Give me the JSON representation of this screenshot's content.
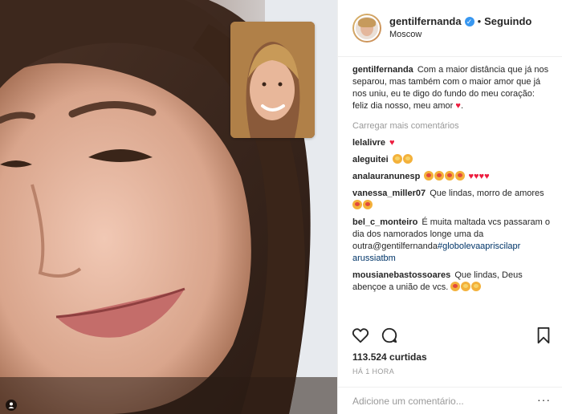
{
  "post": {
    "username": "gentilfernanda",
    "verified": true,
    "separator": "•",
    "follow_status": "Seguindo",
    "location": "Moscow",
    "caption": "Com a maior distância que já nos separou, mas também com o maior amor que já nos uniu, eu te digo do fundo do meu coração: feliz dia nosso, meu amor",
    "load_more": "Carregar mais comentários",
    "likes": "113.524 curtidas",
    "time": "HÁ 1 HORA",
    "add_comment_placeholder": "Adicione um comentário...",
    "more_options": "···"
  },
  "comments": [
    {
      "user": "lelalivre",
      "text": ""
    },
    {
      "user": "aleguitei",
      "text": ""
    },
    {
      "user": "analauranunesp",
      "text": ""
    },
    {
      "user": "vanessa_miller07",
      "text": "Que lindas, morro de amores"
    },
    {
      "user": "bel_c_monteiro",
      "text": "É muita maltada vcs passaram o dia dos namorados longe uma da outra@gentilfernanda",
      "tag": "#globolevaapriscilapr arussiatbm"
    },
    {
      "user": "mousianebastossoares",
      "text": "Que lindas, Deus abençoe a união de vcs."
    }
  ],
  "icons": {
    "like": "heart-outline-icon",
    "comment": "speech-bubble-icon",
    "save": "bookmark-icon",
    "verified": "verified-badge-icon"
  },
  "colors": {
    "accent_blue": "#3897f0",
    "heart_red": "#ed1c3e",
    "muted_text": "#999999",
    "border": "#efefef"
  }
}
